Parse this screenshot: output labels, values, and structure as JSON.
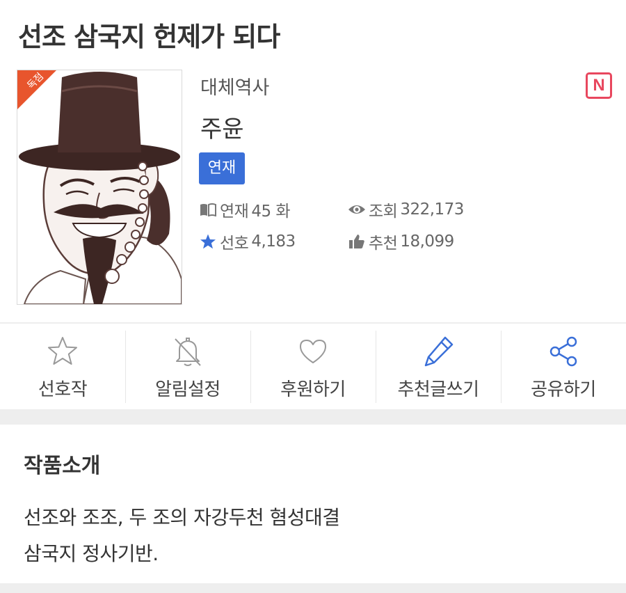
{
  "work": {
    "title": "선조 삼국지 헌제가 되다",
    "genre": "대체역사",
    "author": "주윤",
    "status": "연재",
    "exclusive_label": "독점",
    "platform_badge": "N"
  },
  "stats": {
    "episodes": {
      "label": "연재",
      "value": "45 화",
      "icon": "book-icon"
    },
    "views": {
      "label": "조회",
      "value": "322,173",
      "icon": "eye-icon"
    },
    "favorites": {
      "label": "선호",
      "value": "4,183",
      "icon": "star-icon"
    },
    "recommends": {
      "label": "추천",
      "value": "18,099",
      "icon": "thumbs-up-icon"
    }
  },
  "actions": [
    {
      "label": "선호작",
      "icon": "star-outline-icon"
    },
    {
      "label": "알림설정",
      "icon": "bell-off-icon"
    },
    {
      "label": "후원하기",
      "icon": "heart-icon"
    },
    {
      "label": "추천글쓰기",
      "icon": "pencil-icon"
    },
    {
      "label": "공유하기",
      "icon": "share-icon"
    }
  ],
  "intro": {
    "heading": "작품소개",
    "lines": [
      "선조와 조조, 두 조의 자강두천 혐성대결",
      "삼국지 정사기반."
    ]
  },
  "colors": {
    "accent_blue": "#3a6fd8",
    "platform_red": "#e8475e",
    "exclusive_orange": "#e8552d",
    "text": "#333333",
    "muted": "#666666"
  }
}
